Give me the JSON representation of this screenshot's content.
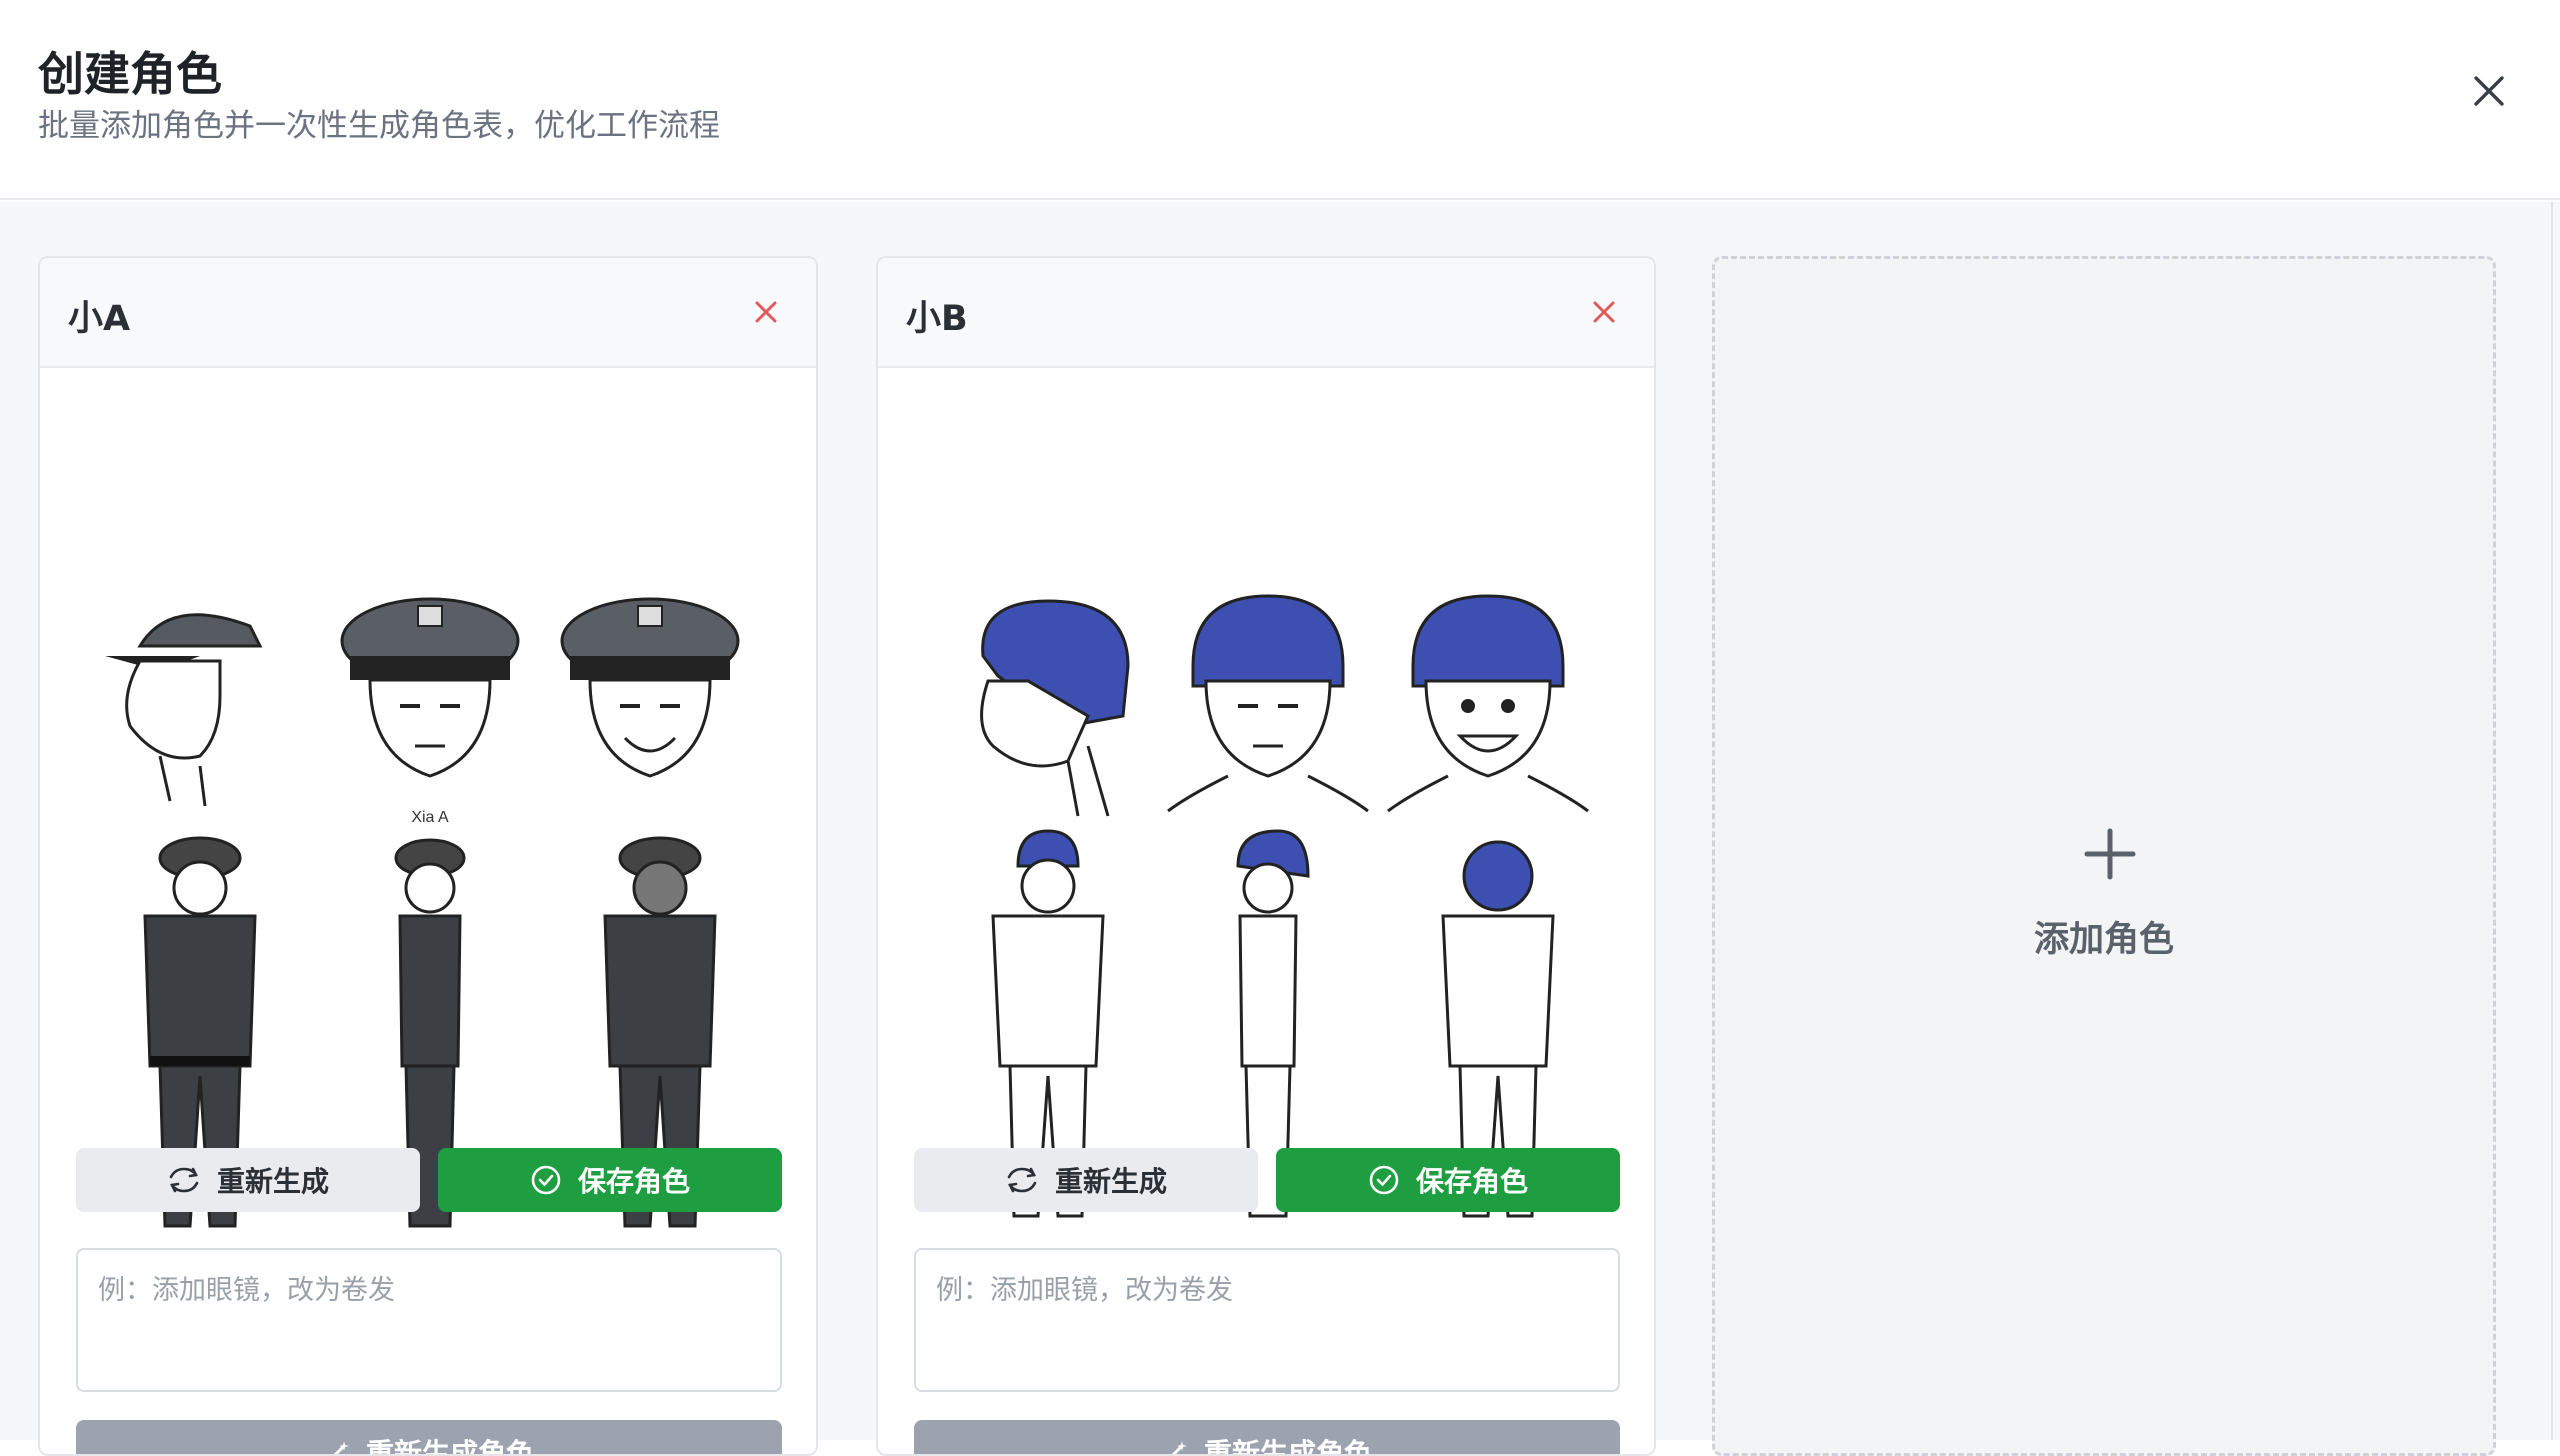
{
  "dialog": {
    "title": "创建角色",
    "subtitle": "批量添加角色并一次性生成角色表，优化工作流程",
    "close_icon": "close-icon"
  },
  "characters": [
    {
      "name": "小A",
      "sheet_caption": "Xia A",
      "hair_color": "#5a5f66",
      "regenerate_label": "重新生成",
      "save_label": "保存角色",
      "edit_placeholder": "例：添加眼镜，改为卷发",
      "edit_value": "",
      "bottom_button_label": "重新生成角色"
    },
    {
      "name": "小B",
      "sheet_caption": "",
      "hair_color": "#3d4fb0",
      "regenerate_label": "重新生成",
      "save_label": "保存角色",
      "edit_placeholder": "例：添加眼镜，改为卷发",
      "edit_value": "",
      "bottom_button_label": "重新生成角色"
    }
  ],
  "add_card": {
    "label": "添加角色",
    "icon": "plus-icon"
  },
  "colors": {
    "accent_green": "#1e9e40",
    "remove_red": "#e05a5a",
    "char_b_hair": "#3d4fb0"
  }
}
